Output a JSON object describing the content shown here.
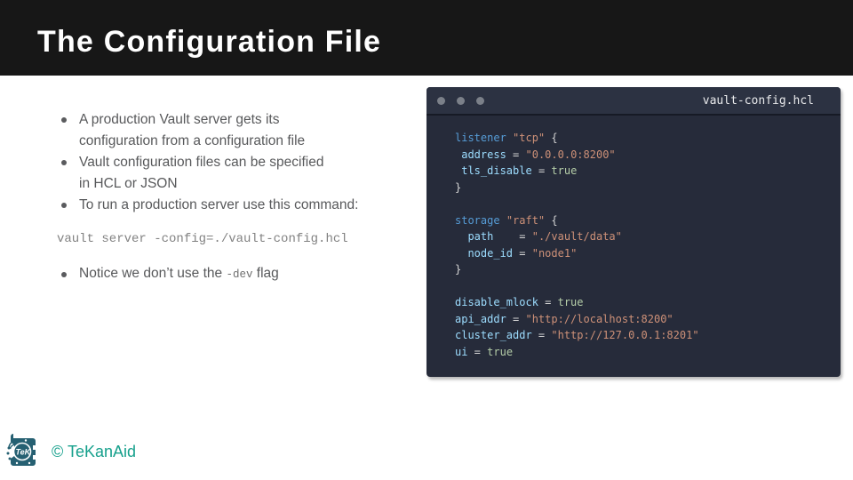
{
  "header": {
    "title": "The Configuration File"
  },
  "bullets": {
    "b1_line1": "A production Vault server gets its",
    "b1_line2": "configuration from a configuration file",
    "b2_line1": "Vault configuration files can be specified",
    "b2_line2": "in HCL or JSON",
    "b3_line1": "To run a production server use this command:"
  },
  "command": "vault server -config=./vault-config.hcl",
  "notice": {
    "before": "Notice we don’t use the ",
    "code": "-dev",
    "after": " flag"
  },
  "terminal": {
    "filename": "vault-config.hcl",
    "colors": {
      "background": "#262b3a",
      "titlebar": "#2c3242",
      "keyword": "#569cd6",
      "property": "#9cdcfe",
      "string": "#ce9178",
      "boolean": "#b5cea8",
      "punctuation": "#d4d4d4"
    },
    "lines": [
      [
        [
          "kw",
          "listener"
        ],
        [
          "pn",
          " "
        ],
        [
          "st",
          "\"tcp\""
        ],
        [
          "pn",
          " {"
        ]
      ],
      [
        [
          "pn",
          " "
        ],
        [
          "pr",
          "address"
        ],
        [
          "pn",
          " = "
        ],
        [
          "st",
          "\"0.0.0.0:8200\""
        ]
      ],
      [
        [
          "pn",
          " "
        ],
        [
          "pr",
          "tls_disable"
        ],
        [
          "pn",
          " = "
        ],
        [
          "bo",
          "true"
        ]
      ],
      [
        [
          "pn",
          "}"
        ]
      ],
      [],
      [
        [
          "kw",
          "storage"
        ],
        [
          "pn",
          " "
        ],
        [
          "st",
          "\"raft\""
        ],
        [
          "pn",
          " {"
        ]
      ],
      [
        [
          "pn",
          "  "
        ],
        [
          "pr",
          "path"
        ],
        [
          "pn",
          "    = "
        ],
        [
          "st",
          "\"./vault/data\""
        ]
      ],
      [
        [
          "pn",
          "  "
        ],
        [
          "pr",
          "node_id"
        ],
        [
          "pn",
          " = "
        ],
        [
          "st",
          "\"node1\""
        ]
      ],
      [
        [
          "pn",
          "}"
        ]
      ],
      [],
      [
        [
          "pr",
          "disable_mlock"
        ],
        [
          "pn",
          " = "
        ],
        [
          "bo",
          "true"
        ]
      ],
      [
        [
          "pr",
          "api_addr"
        ],
        [
          "pn",
          " = "
        ],
        [
          "st",
          "\"http://localhost:8200\""
        ]
      ],
      [
        [
          "pr",
          "cluster_addr"
        ],
        [
          "pn",
          " = "
        ],
        [
          "st",
          "\"http://127.0.0.1:8201\""
        ]
      ],
      [
        [
          "pr",
          "ui"
        ],
        [
          "pn",
          " = "
        ],
        [
          "bo",
          "true"
        ]
      ]
    ]
  },
  "footer": {
    "copyright": "© TeKanAid",
    "accent_color": "#16a08c"
  }
}
